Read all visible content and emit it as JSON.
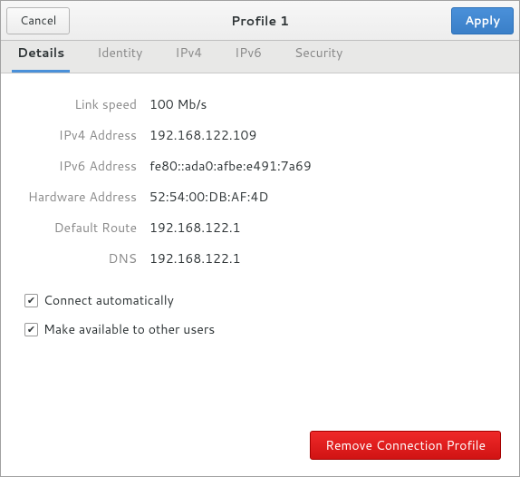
{
  "header": {
    "cancel_label": "Cancel",
    "title": "Profile 1",
    "apply_label": "Apply"
  },
  "tabs": {
    "details": "Details",
    "identity": "Identity",
    "ipv4": "IPv4",
    "ipv6": "IPv6",
    "security": "Security"
  },
  "details": {
    "link_speed_label": "Link speed",
    "link_speed_value": "100 Mb/s",
    "ipv4_address_label": "IPv4 Address",
    "ipv4_address_value": "192.168.122.109",
    "ipv6_address_label": "IPv6 Address",
    "ipv6_address_value": "fe80::ada0:afbe:e491:7a69",
    "hardware_address_label": "Hardware Address",
    "hardware_address_value": "52:54:00:DB:AF:4D",
    "default_route_label": "Default Route",
    "default_route_value": "192.168.122.1",
    "dns_label": "DNS",
    "dns_value": "192.168.122.1"
  },
  "checks": {
    "connect_auto_label": "Connect automatically",
    "connect_auto_checked": true,
    "available_others_label": "Make available to other users",
    "available_others_checked": true
  },
  "footer": {
    "remove_label": "Remove Connection Profile"
  }
}
